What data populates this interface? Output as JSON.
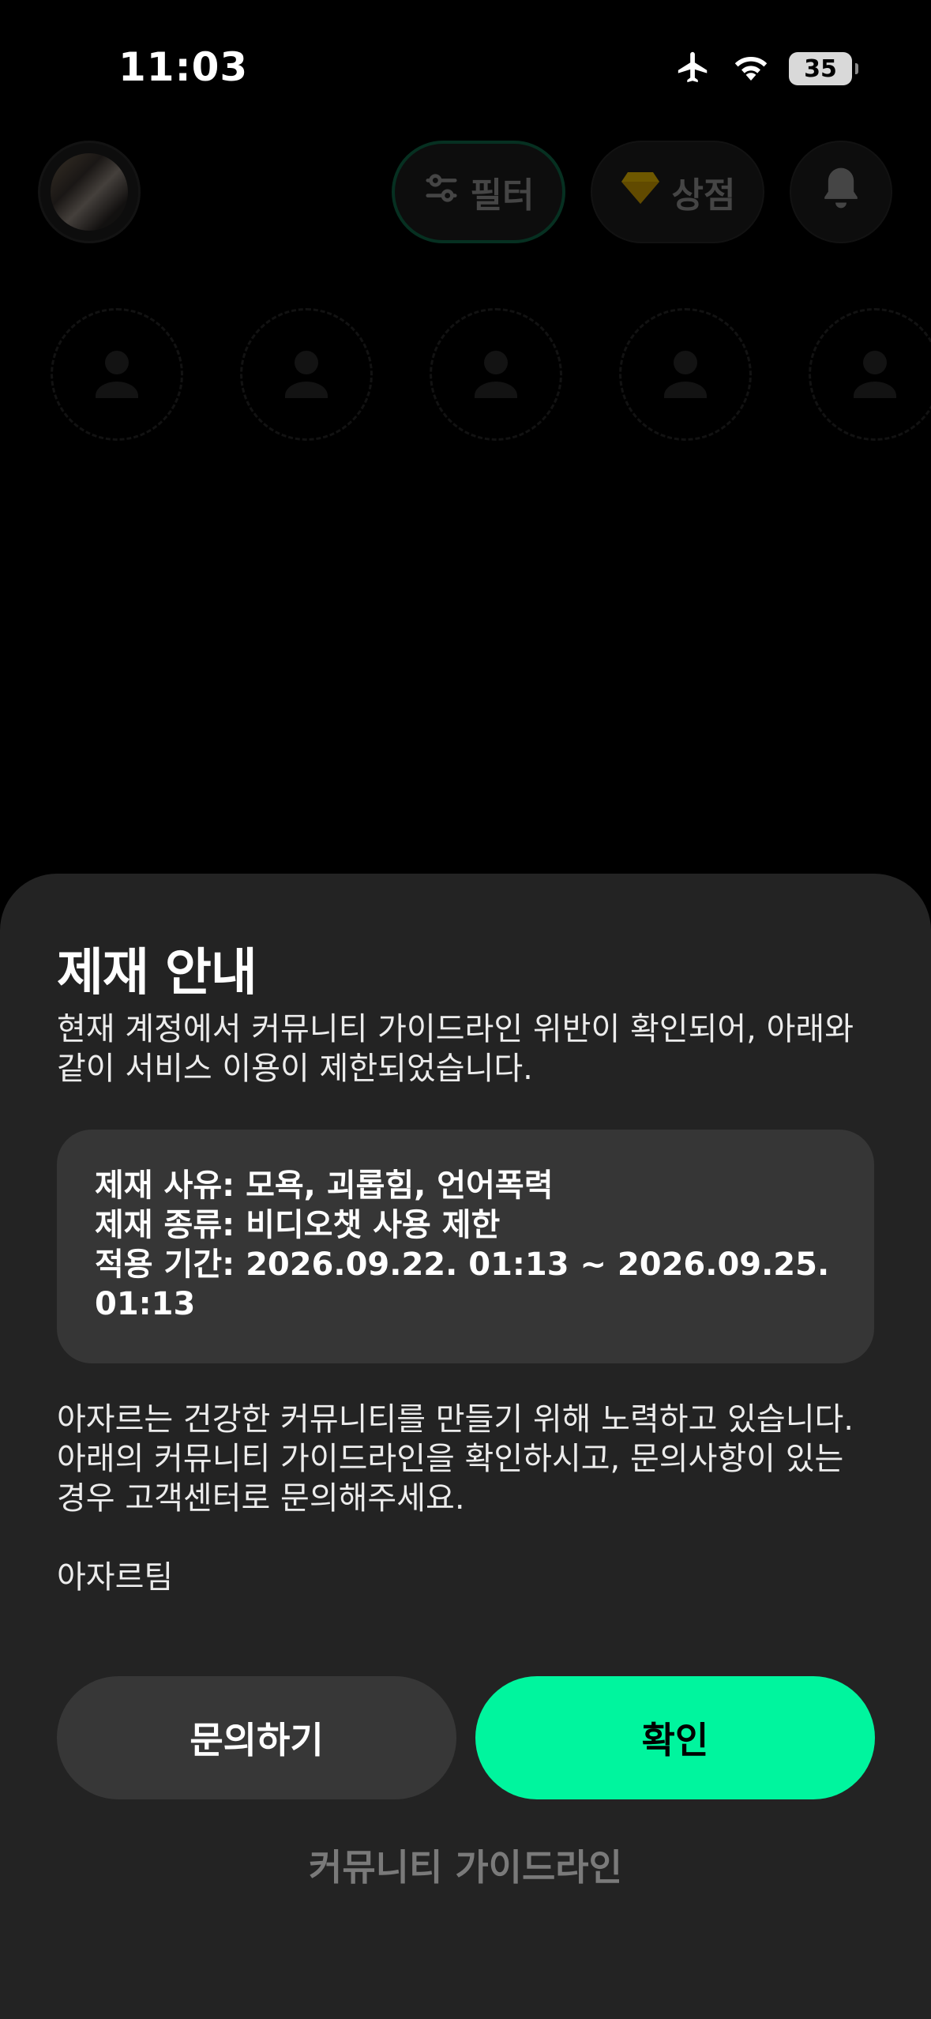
{
  "status_bar": {
    "time": "11:03",
    "battery": "35",
    "icons": [
      "airplane-icon",
      "wifi-icon",
      "battery-icon"
    ]
  },
  "header": {
    "filter_label": "필터",
    "shop_label": "상점",
    "icons": [
      "profile-avatar",
      "filter-sliders-icon",
      "diamond-icon",
      "bell-icon"
    ],
    "filter_border_color": "#0f6b4a",
    "diamond_color": "#f5c400"
  },
  "sheet": {
    "title": "제재 안내",
    "description_line1": "현재 계정에서 커뮤니티 가이드라인 위반이 확인되어, 아래와",
    "description_line2": "같이 서비스 이용이 제한되었습니다.",
    "info": {
      "reason_label": "제재 사유:",
      "reason_value": "모욕, 괴롭힘, 언어폭력",
      "type_label": "제재 종류:",
      "type_value": "비디오챗 사용 제한",
      "period_label": "적용 기간:",
      "period_value_line1": "2026.09.22. 01:13 ~ 2026.09.25.",
      "period_value_line2": "01:13"
    },
    "body_line1": "아자르는 건강한 커뮤니티를 만들기 위해 노력하고 있습니다.",
    "body_line2": "아래의 커뮤니티 가이드라인을 확인하시고, 문의사항이 있는",
    "body_line3": "경우 고객센터로 문의해주세요.",
    "signature": "아자르팀",
    "inquiry_button": "문의하기",
    "confirm_button": "확인",
    "guideline_link": "커뮤니티 가이드라인",
    "accent_color": "#00f59e"
  }
}
